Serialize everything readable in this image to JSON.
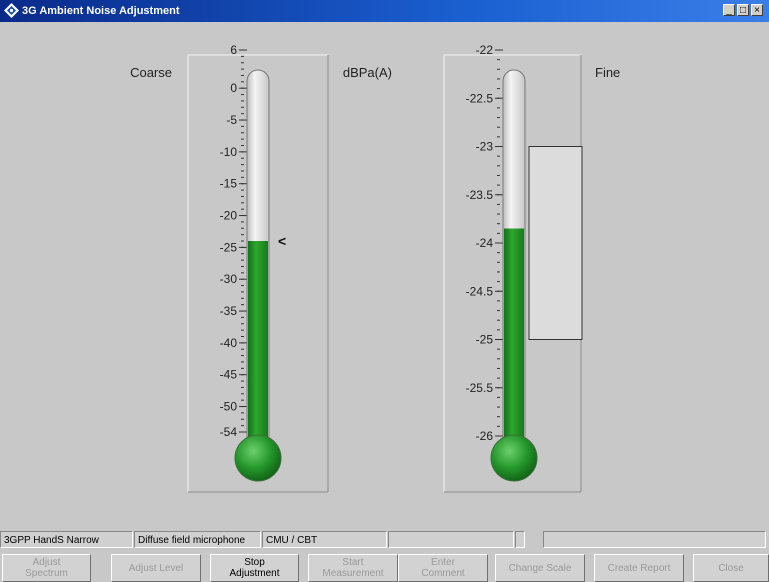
{
  "window": {
    "title": "3G Ambient Noise Adjustment",
    "controls": [
      "_",
      "□",
      "×"
    ]
  },
  "labels": {
    "coarse": "Coarse",
    "unit": "dBPa(A)",
    "fine": "Fine"
  },
  "coarse_gauge": {
    "min": -54,
    "max": 6,
    "level": -24,
    "ticks": [
      "6",
      "0",
      "-5",
      "-10",
      "-15",
      "-20",
      "-25",
      "-30",
      "-35",
      "-40",
      "-45",
      "-50",
      "-54"
    ],
    "tick_values": [
      6,
      0,
      -5,
      -10,
      -15,
      -20,
      -25,
      -30,
      -35,
      -40,
      -45,
      -50,
      -54
    ],
    "marker": "<"
  },
  "fine_gauge": {
    "min": -26,
    "max": -22,
    "level": -23.85,
    "ticks": [
      "-22",
      "-22.5",
      "-23",
      "-23.5",
      "-24",
      "-24.5",
      "-25",
      "-25.5",
      "-26"
    ],
    "tick_values": [
      -22,
      -22.5,
      -23,
      -23.5,
      -24,
      -24.5,
      -25,
      -25.5,
      -26
    ],
    "window_range": [
      -25,
      -23
    ]
  },
  "status_bar": [
    "3GPP HandS Narrow",
    "Diffuse field microphone",
    "CMU / CBT",
    "",
    "",
    ""
  ],
  "buttons": [
    {
      "label": "Adjust\nSpectrum",
      "enabled": false
    },
    {
      "label": "Adjust Level",
      "enabled": false
    },
    {
      "label": "Stop\nAdjustment",
      "enabled": true
    },
    {
      "label": "Start\nMeasurement",
      "enabled": false
    },
    {
      "label": "Enter\nComment",
      "enabled": false
    },
    {
      "label": "Change Scale",
      "enabled": false
    },
    {
      "label": "Create Report",
      "enabled": false
    },
    {
      "label": "Close",
      "enabled": false
    }
  ],
  "colors": {
    "mercury": "#1f8a1f",
    "tube_empty": "#e6e6e6",
    "panel": "#c8c8c8",
    "titlebar": "#0a2a8a"
  }
}
